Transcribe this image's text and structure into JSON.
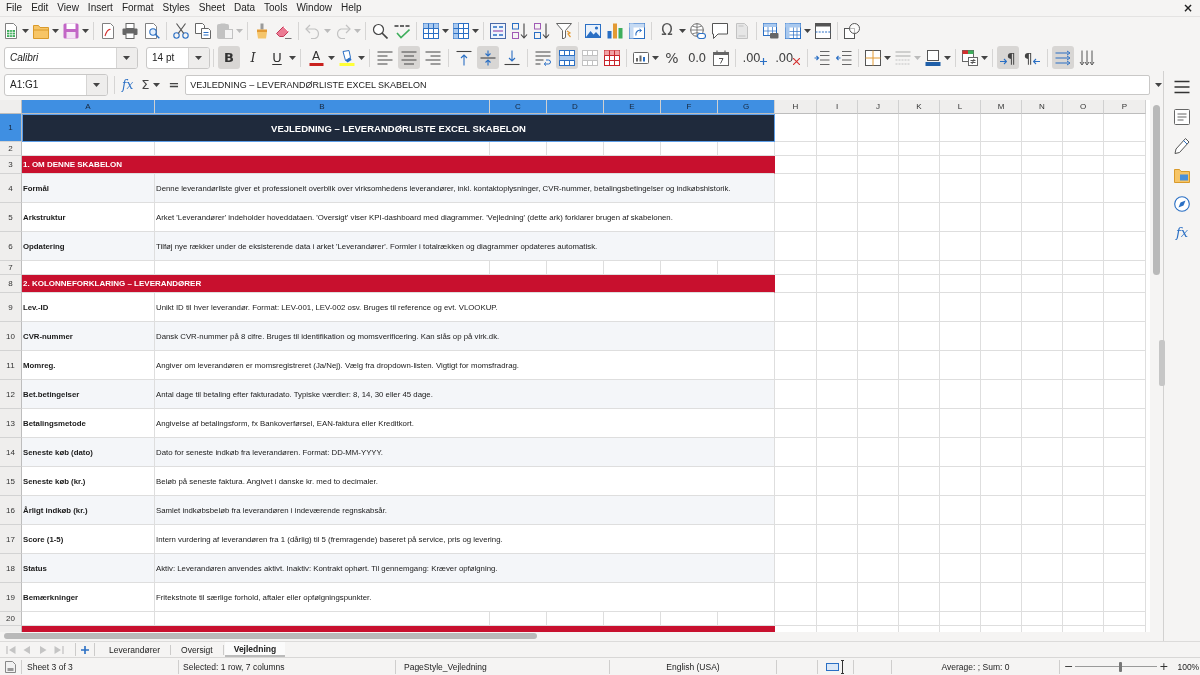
{
  "menu_bar": {
    "items": [
      "File",
      "Edit",
      "View",
      "Insert",
      "Format",
      "Styles",
      "Sheet",
      "Data",
      "Tools",
      "Window",
      "Help"
    ],
    "close": "×"
  },
  "standard_toolbar": {
    "paste": {
      "disabled": true
    },
    "undo": {
      "disabled": true
    },
    "redo": {
      "disabled": true
    },
    "special_character": {
      "label": "Ω"
    },
    "header_footer": {
      "disabled": true
    }
  },
  "formatting_toolbar": {
    "font_name": "Calibri",
    "font_size": "14 pt",
    "bold": {
      "label": "B",
      "selected": true
    },
    "italic": {
      "label": "I",
      "selected": false
    },
    "underline": {
      "label": "U",
      "selected": false
    },
    "font_color": {
      "label": "A"
    },
    "align_left": {
      "selected": false
    },
    "align_center": {
      "selected": true
    },
    "align_right": {
      "selected": false
    },
    "align_top": {
      "selected": false
    },
    "align_middle": {
      "selected": true
    },
    "align_bottom": {
      "selected": false
    },
    "wrap_text": {
      "selected": false
    },
    "merge_and_center": {
      "selected": true
    },
    "merge_cells": {
      "disabled": true
    },
    "percent": {
      "label": "%"
    },
    "number_format": {
      "label": "0.0"
    },
    "add_decimal": {
      "label": ".00"
    },
    "delete_decimal": {
      "label": ".00"
    },
    "border_style": {
      "disabled": true
    },
    "left_to_right": {
      "label": "¶",
      "selected": true
    },
    "right_to_left": {
      "label": "¶",
      "selected": false
    },
    "text_horizontal": {
      "selected": true
    },
    "text_vertical": {
      "selected": false
    }
  },
  "formula_bar": {
    "name_box": "A1:G1",
    "function_wizard": "fx",
    "sum": "Σ",
    "formula": "=",
    "content": "VEJLEDNING – LEVERANDØRLISTE EXCEL SKABELON"
  },
  "sidebar": {
    "functions": "fx"
  },
  "sheet": {
    "columns": [
      {
        "label": "A",
        "selected": true
      },
      {
        "label": "B",
        "selected": true
      },
      {
        "label": "C",
        "selected": true
      },
      {
        "label": "D",
        "selected": true
      },
      {
        "label": "E",
        "selected": true
      },
      {
        "label": "F",
        "selected": true
      },
      {
        "label": "G",
        "selected": true
      },
      {
        "label": "H",
        "selected": false
      },
      {
        "label": "I",
        "selected": false
      },
      {
        "label": "J",
        "selected": false
      },
      {
        "label": "K",
        "selected": false
      },
      {
        "label": "L",
        "selected": false
      },
      {
        "label": "M",
        "selected": false
      },
      {
        "label": "N",
        "selected": false
      },
      {
        "label": "O",
        "selected": false
      },
      {
        "label": "P",
        "selected": false
      }
    ],
    "rows": [
      {
        "number": "1",
        "selected": true,
        "kind": "title",
        "title": "VEJLEDNING – LEVERANDØRLISTE EXCEL SKABELON"
      },
      {
        "number": "2",
        "selected": false,
        "kind": "blank"
      },
      {
        "number": "3",
        "selected": false,
        "kind": "section",
        "text": "1. OM DENNE SKABELON"
      },
      {
        "number": "4",
        "selected": false,
        "kind": "entry",
        "label": "Formål",
        "description": "Denne leverandørliste giver et professionelt overblik over virksomhedens leverandører, inkl. kontaktoplysninger, CVR-nummer, betalingsbetingelser og indkøbshistorik."
      },
      {
        "number": "5",
        "selected": false,
        "kind": "entry",
        "label": "Arkstruktur",
        "description": "Arket 'Leverandører' indeholder hoveddataen. 'Oversigt' viser KPI-dashboard med diagrammer. 'Vejledning' (dette ark) forklarer brugen af skabelonen."
      },
      {
        "number": "6",
        "selected": false,
        "kind": "entry",
        "label": "Opdatering",
        "description": "Tilføj nye rækker under de eksisterende data i arket 'Leverandører'. Formler i totalrækken og diagrammer opdateres automatisk."
      },
      {
        "number": "7",
        "selected": false,
        "kind": "blank"
      },
      {
        "number": "8",
        "selected": false,
        "kind": "section",
        "text": "2. KOLONNEFORKLARING – LEVERANDØRER"
      },
      {
        "number": "9",
        "selected": false,
        "kind": "entry",
        "label": "Lev.-ID",
        "description": "Unikt ID til hver leverandør. Format: LEV-001, LEV-002 osv. Bruges til reference og evt. VLOOKUP."
      },
      {
        "number": "10",
        "selected": false,
        "kind": "entry",
        "label": "CVR-nummer",
        "description": "Dansk CVR-nummer på 8 cifre. Bruges til identifikation og momsverificering. Kan slås op på virk.dk."
      },
      {
        "number": "11",
        "selected": false,
        "kind": "entry",
        "label": "Momreg.",
        "description": "Angiver om leverandøren er momsregistreret (Ja/Nej). Vælg fra dropdown-listen. Vigtigt for momsfradrag."
      },
      {
        "number": "12",
        "selected": false,
        "kind": "entry",
        "label": "Bet.betingelser",
        "description": "Antal dage til betaling efter fakturadato. Typiske værdier: 8, 14, 30 eller 45 dage."
      },
      {
        "number": "13",
        "selected": false,
        "kind": "entry",
        "label": "Betalingsmetode",
        "description": "Angivelse af betalingsform, fx Bankoverførsel, EAN-faktura eller Kreditkort."
      },
      {
        "number": "14",
        "selected": false,
        "kind": "entry",
        "label": "Seneste køb (dato)",
        "description": "Dato for seneste indkøb fra leverandøren. Format: DD-MM-YYYY."
      },
      {
        "number": "15",
        "selected": false,
        "kind": "entry",
        "label": "Seneste køb (kr.)",
        "description": "Beløb på seneste faktura. Angivet i danske kr. med to decimaler."
      },
      {
        "number": "16",
        "selected": false,
        "kind": "entry",
        "label": "Årligt indkøb (kr.)",
        "description": "Samlet indkøbsbeløb fra leverandøren i indeværende regnskabsår."
      },
      {
        "number": "17",
        "selected": false,
        "kind": "entry",
        "label": "Score (1-5)",
        "description": "Intern vurdering af leverandøren fra 1 (dårlig) til 5 (fremragende) baseret på service, pris og levering."
      },
      {
        "number": "18",
        "selected": false,
        "kind": "entry",
        "label": "Status",
        "description": "Aktiv: Leverandøren anvendes aktivt. Inaktiv: Kontrakt ophørt. Til gennemgang: Kræver opfølgning."
      },
      {
        "number": "19",
        "selected": false,
        "kind": "entry",
        "label": "Bemærkninger",
        "description": "Fritekstnote til særlige forhold, aftaler eller opfølgningspunkter."
      },
      {
        "number": "20",
        "selected": false,
        "kind": "blank"
      },
      {
        "selected": false,
        "kind": "section"
      }
    ]
  },
  "sheet_tabs": {
    "navigation_disabled": true,
    "tabs": [
      {
        "label": "Leverandører",
        "selected": false
      },
      {
        "label": "Oversigt",
        "selected": false
      },
      {
        "label": "Vejledning",
        "selected": true
      }
    ]
  },
  "status_bar": {
    "sheet_position": "Sheet 3 of 3",
    "selection": "Selected: 1 row, 7 columns",
    "page_style": "PageStyle_Vejledning",
    "language": "English (USA)",
    "summary": "Average: ; Sum: 0",
    "zoom_out": "−",
    "zoom_slider": {
      "level": 0.55
    },
    "zoom_in": "+",
    "zoom": "100%"
  }
}
